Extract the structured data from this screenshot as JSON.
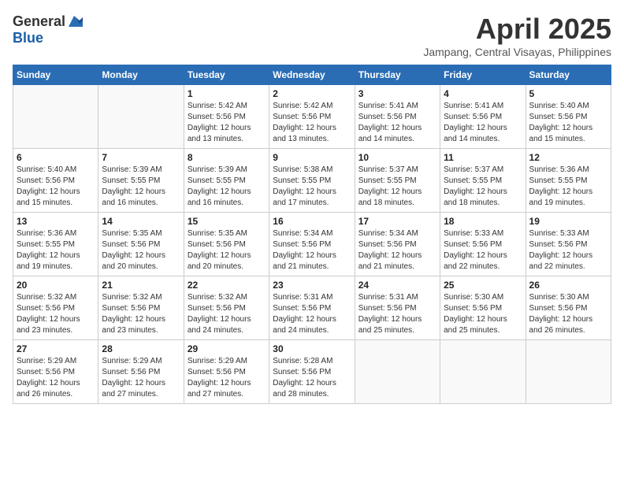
{
  "logo": {
    "text_general": "General",
    "text_blue": "Blue"
  },
  "header": {
    "month": "April 2025",
    "location": "Jampang, Central Visayas, Philippines"
  },
  "weekdays": [
    "Sunday",
    "Monday",
    "Tuesday",
    "Wednesday",
    "Thursday",
    "Friday",
    "Saturday"
  ],
  "weeks": [
    [
      {
        "day": "",
        "info": ""
      },
      {
        "day": "",
        "info": ""
      },
      {
        "day": "1",
        "info": "Sunrise: 5:42 AM\nSunset: 5:56 PM\nDaylight: 12 hours\nand 13 minutes."
      },
      {
        "day": "2",
        "info": "Sunrise: 5:42 AM\nSunset: 5:56 PM\nDaylight: 12 hours\nand 13 minutes."
      },
      {
        "day": "3",
        "info": "Sunrise: 5:41 AM\nSunset: 5:56 PM\nDaylight: 12 hours\nand 14 minutes."
      },
      {
        "day": "4",
        "info": "Sunrise: 5:41 AM\nSunset: 5:56 PM\nDaylight: 12 hours\nand 14 minutes."
      },
      {
        "day": "5",
        "info": "Sunrise: 5:40 AM\nSunset: 5:56 PM\nDaylight: 12 hours\nand 15 minutes."
      }
    ],
    [
      {
        "day": "6",
        "info": "Sunrise: 5:40 AM\nSunset: 5:56 PM\nDaylight: 12 hours\nand 15 minutes."
      },
      {
        "day": "7",
        "info": "Sunrise: 5:39 AM\nSunset: 5:55 PM\nDaylight: 12 hours\nand 16 minutes."
      },
      {
        "day": "8",
        "info": "Sunrise: 5:39 AM\nSunset: 5:55 PM\nDaylight: 12 hours\nand 16 minutes."
      },
      {
        "day": "9",
        "info": "Sunrise: 5:38 AM\nSunset: 5:55 PM\nDaylight: 12 hours\nand 17 minutes."
      },
      {
        "day": "10",
        "info": "Sunrise: 5:37 AM\nSunset: 5:55 PM\nDaylight: 12 hours\nand 18 minutes."
      },
      {
        "day": "11",
        "info": "Sunrise: 5:37 AM\nSunset: 5:55 PM\nDaylight: 12 hours\nand 18 minutes."
      },
      {
        "day": "12",
        "info": "Sunrise: 5:36 AM\nSunset: 5:55 PM\nDaylight: 12 hours\nand 19 minutes."
      }
    ],
    [
      {
        "day": "13",
        "info": "Sunrise: 5:36 AM\nSunset: 5:55 PM\nDaylight: 12 hours\nand 19 minutes."
      },
      {
        "day": "14",
        "info": "Sunrise: 5:35 AM\nSunset: 5:56 PM\nDaylight: 12 hours\nand 20 minutes."
      },
      {
        "day": "15",
        "info": "Sunrise: 5:35 AM\nSunset: 5:56 PM\nDaylight: 12 hours\nand 20 minutes."
      },
      {
        "day": "16",
        "info": "Sunrise: 5:34 AM\nSunset: 5:56 PM\nDaylight: 12 hours\nand 21 minutes."
      },
      {
        "day": "17",
        "info": "Sunrise: 5:34 AM\nSunset: 5:56 PM\nDaylight: 12 hours\nand 21 minutes."
      },
      {
        "day": "18",
        "info": "Sunrise: 5:33 AM\nSunset: 5:56 PM\nDaylight: 12 hours\nand 22 minutes."
      },
      {
        "day": "19",
        "info": "Sunrise: 5:33 AM\nSunset: 5:56 PM\nDaylight: 12 hours\nand 22 minutes."
      }
    ],
    [
      {
        "day": "20",
        "info": "Sunrise: 5:32 AM\nSunset: 5:56 PM\nDaylight: 12 hours\nand 23 minutes."
      },
      {
        "day": "21",
        "info": "Sunrise: 5:32 AM\nSunset: 5:56 PM\nDaylight: 12 hours\nand 23 minutes."
      },
      {
        "day": "22",
        "info": "Sunrise: 5:32 AM\nSunset: 5:56 PM\nDaylight: 12 hours\nand 24 minutes."
      },
      {
        "day": "23",
        "info": "Sunrise: 5:31 AM\nSunset: 5:56 PM\nDaylight: 12 hours\nand 24 minutes."
      },
      {
        "day": "24",
        "info": "Sunrise: 5:31 AM\nSunset: 5:56 PM\nDaylight: 12 hours\nand 25 minutes."
      },
      {
        "day": "25",
        "info": "Sunrise: 5:30 AM\nSunset: 5:56 PM\nDaylight: 12 hours\nand 25 minutes."
      },
      {
        "day": "26",
        "info": "Sunrise: 5:30 AM\nSunset: 5:56 PM\nDaylight: 12 hours\nand 26 minutes."
      }
    ],
    [
      {
        "day": "27",
        "info": "Sunrise: 5:29 AM\nSunset: 5:56 PM\nDaylight: 12 hours\nand 26 minutes."
      },
      {
        "day": "28",
        "info": "Sunrise: 5:29 AM\nSunset: 5:56 PM\nDaylight: 12 hours\nand 27 minutes."
      },
      {
        "day": "29",
        "info": "Sunrise: 5:29 AM\nSunset: 5:56 PM\nDaylight: 12 hours\nand 27 minutes."
      },
      {
        "day": "30",
        "info": "Sunrise: 5:28 AM\nSunset: 5:56 PM\nDaylight: 12 hours\nand 28 minutes."
      },
      {
        "day": "",
        "info": ""
      },
      {
        "day": "",
        "info": ""
      },
      {
        "day": "",
        "info": ""
      }
    ]
  ]
}
